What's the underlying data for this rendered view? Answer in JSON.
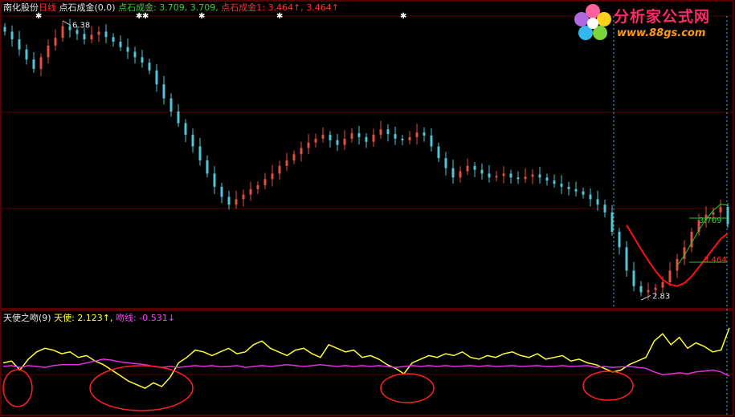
{
  "header": {
    "stock_name": "南化股份",
    "period": "日线",
    "indicator_call": "点石成金(0,0)",
    "line1_label": "点石成金:",
    "line1_values": "3.709, 3.709,",
    "line2_label": "点石成金1:",
    "line2_values": "3.464↑, 3.464↑"
  },
  "sub_header": {
    "indicator_call": "天使之吻(9)",
    "angel_label": "天使:",
    "angel_value": "2.123↑,",
    "kiss_label": "吻线:",
    "kiss_value": "-0.531↓"
  },
  "logo": {
    "title": "分析家公式网",
    "url": "www.88gs.com"
  },
  "colors": {
    "frame": "#b00000",
    "candle_up": "#e05040",
    "candle_down": "#4ec8d8",
    "ma_green": "#22cc22",
    "ma_red": "#ff1010",
    "angel_line": "#ffff30",
    "kiss_line": "#e030e0",
    "circle": "#ff2020",
    "text_white": "#e8e8e8",
    "text_yellow": "#ffff40",
    "text_green": "#22dd22",
    "text_red": "#ff3030",
    "text_magenta": "#ff40ff",
    "marker_cyan": "#30c8e8"
  },
  "chart_data": [
    {
      "type": "candlestick",
      "price_range": [
        2.76,
        6.46
      ],
      "annotations": {
        "high_label": "6.38",
        "low_label": "2.83",
        "ma_green_label": "3.709",
        "ma_red_label": "3.464"
      },
      "closes": [
        6.28,
        6.18,
        6.05,
        5.92,
        5.8,
        5.95,
        6.1,
        6.2,
        6.35,
        6.3,
        6.25,
        6.18,
        6.24,
        6.28,
        6.21,
        6.15,
        6.08,
        6.02,
        5.95,
        5.88,
        5.78,
        5.6,
        5.42,
        5.25,
        5.1,
        4.95,
        4.8,
        4.62,
        4.45,
        4.28,
        4.15,
        4.05,
        4.12,
        4.18,
        4.25,
        4.3,
        4.38,
        4.45,
        4.55,
        4.62,
        4.7,
        4.78,
        4.85,
        4.9,
        4.95,
        4.88,
        4.82,
        4.9,
        4.97,
        4.92,
        4.86,
        4.95,
        5.02,
        4.96,
        4.9,
        4.88,
        4.92,
        4.98,
        4.94,
        4.8,
        4.65,
        4.52,
        4.4,
        4.48,
        4.55,
        4.5,
        4.45,
        4.4,
        4.42,
        4.45,
        4.4,
        4.38,
        4.41,
        4.44,
        4.4,
        4.36,
        4.32,
        4.28,
        4.25,
        4.22,
        4.18,
        4.12,
        4.05,
        3.95,
        3.7,
        3.5,
        3.2,
        3.0,
        2.92,
        2.95,
        2.98,
        3.05,
        3.2,
        3.35,
        3.5,
        3.7,
        3.85,
        3.92,
        3.95,
        4.02,
        3.8
      ],
      "ma_green_start_index": 93,
      "ma_red_start_index": 86
    },
    {
      "type": "line",
      "y_range": [
        -2.6,
        2.6
      ],
      "series": [
        {
          "name": "天使",
          "values": [
            0.2,
            0.3,
            -0.2,
            0.4,
            0.8,
            1.0,
            0.9,
            0.7,
            0.8,
            0.5,
            0.6,
            0.3,
            0.1,
            -0.2,
            -0.5,
            -0.8,
            -1.0,
            -1.2,
            -0.9,
            -1.1,
            -0.6,
            0.2,
            0.5,
            0.9,
            0.8,
            0.6,
            0.8,
            1.0,
            0.7,
            0.8,
            1.2,
            1.4,
            1.0,
            0.8,
            0.6,
            0.9,
            1.0,
            0.7,
            0.5,
            1.2,
            1.0,
            0.8,
            0.9,
            0.5,
            0.6,
            0.4,
            0.1,
            -0.1,
            -0.4,
            0.2,
            0.4,
            0.6,
            0.5,
            0.7,
            0.6,
            0.8,
            0.5,
            0.4,
            0.6,
            0.5,
            0.7,
            0.8,
            0.6,
            0.5,
            0.7,
            0.4,
            0.5,
            0.6,
            0.3,
            0.4,
            0.2,
            0.1,
            -0.1,
            -0.3,
            -0.2,
            0.1,
            0.3,
            0.5,
            1.4,
            1.8,
            1.2,
            1.6,
            1.0,
            1.3,
            1.1,
            0.8,
            0.9,
            2.12
          ]
        },
        {
          "name": "吻线",
          "values": [
            0.0,
            0.05,
            -0.05,
            0.05,
            0.0,
            -0.05,
            0.05,
            0.1,
            0.1,
            0.1,
            0.2,
            0.3,
            0.4,
            0.35,
            0.25,
            0.2,
            0.15,
            0.1,
            0.0,
            -0.05,
            0.0,
            -0.05,
            0.0,
            0.05,
            0.0,
            0.05,
            -0.02,
            0.0,
            0.05,
            -0.05,
            0.0,
            0.05,
            0.0,
            0.05,
            0.1,
            0.05,
            0.0,
            0.05,
            0.1,
            0.05,
            0.0,
            0.05,
            0.0,
            0.05,
            0.0,
            0.05,
            0.0,
            -0.05,
            0.0,
            0.05,
            0.0,
            0.05,
            0.0,
            0.05,
            0.0,
            0.02,
            0.05,
            0.0,
            0.05,
            0.0,
            0.02,
            0.05,
            0.0,
            0.02,
            0.05,
            0.0,
            0.0,
            0.05,
            0.0,
            0.02,
            0.05,
            -0.05,
            0.0,
            -0.05,
            -0.02,
            0.0,
            -0.05,
            -0.1,
            -0.3,
            -0.45,
            -0.4,
            -0.35,
            -0.4,
            -0.3,
            -0.25,
            -0.2,
            -0.3,
            -0.531
          ]
        }
      ],
      "highlight_circles": 5
    }
  ]
}
